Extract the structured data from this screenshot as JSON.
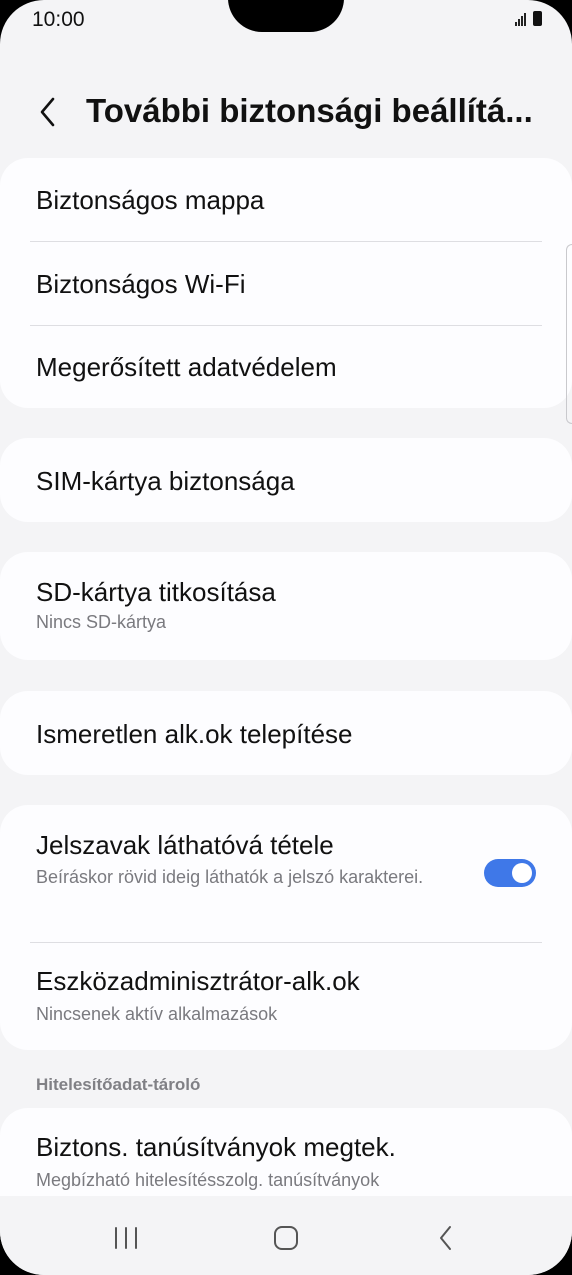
{
  "status_bar": {
    "time": "10:00",
    "signal_icon": "signal-icon",
    "battery_icon": "battery-icon"
  },
  "header": {
    "title": "További biztonsági beállítá...",
    "back_icon": "chevron-left-icon"
  },
  "groups": [
    {
      "items": [
        {
          "title": "Biztonságos mappa"
        },
        {
          "title": "Biztonságos Wi-Fi"
        },
        {
          "title": "Megerősített adatvédelem"
        }
      ]
    },
    {
      "items": [
        {
          "title": "SIM-kártya biztonsága"
        }
      ]
    },
    {
      "items": [
        {
          "title": "SD-kártya titkosítása",
          "subtitle": "Nincs SD-kártya"
        }
      ]
    },
    {
      "items": [
        {
          "title": "Ismeretlen alk.ok telepítése"
        }
      ]
    },
    {
      "items": [
        {
          "title": "Jelszavak láthatóvá tétele",
          "subtitle": "Beíráskor rövid ideig láthatók a jelszó karakterei.",
          "toggle_on": true
        },
        {
          "title": "Eszközadminisztrátor-alk.ok",
          "subtitle": "Nincsenek aktív alkalmazások"
        }
      ]
    }
  ],
  "section": {
    "label": "Hitelesítőadat-tároló"
  },
  "last_item": {
    "title": "Biztons. tanúsítványok megtek.",
    "subtitle": "Megbízható hitelesítésszolg. tanúsítványok"
  },
  "colors": {
    "toggle_on": "#3f78e8",
    "background": "#f4f4f6",
    "card": "#fdfdff"
  },
  "nav": {
    "recents_icon": "recents-icon",
    "home_icon": "home-icon",
    "back_icon": "back-icon"
  }
}
